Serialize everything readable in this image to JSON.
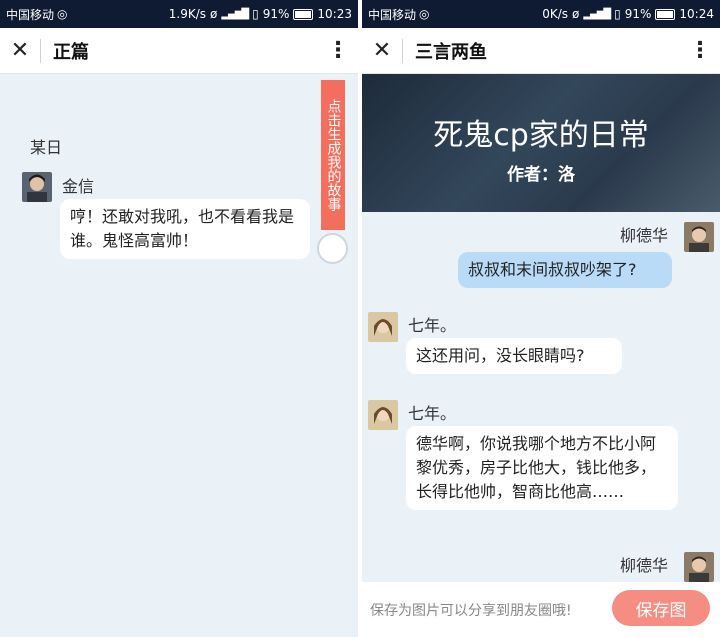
{
  "left": {
    "status": {
      "carrier": "中国移动",
      "speed": "1.9K/s",
      "battery": "91%",
      "time": "10:23"
    },
    "title": "正篇",
    "day_label": "某日",
    "messages": [
      {
        "speaker": "金信",
        "text": "哼！还敢对我吼，也不看看我是谁。鬼怪高富帅！"
      }
    ],
    "generate_tab": "点击生成我的故事"
  },
  "right": {
    "status": {
      "carrier": "中国移动",
      "speed": "0K/s",
      "battery": "91%",
      "time": "10:24"
    },
    "title": "三言两鱼",
    "banner": {
      "title": "死鬼cp家的日常",
      "author": "作者：洛"
    },
    "messages": [
      {
        "speaker": "柳德华",
        "text": "叔叔和末间叔叔吵架了?"
      },
      {
        "speaker": "七年。",
        "text": "这还用问，没长眼睛吗?"
      },
      {
        "speaker": "七年。",
        "text": "德华啊，你说我哪个地方不比小阿黎优秀，房子比他大，钱比他多，长得比他帅，智商比他高……"
      },
      {
        "speaker": "柳德华",
        "text": ""
      }
    ],
    "save_hint": "保存为图片可以分享到朋友圈哦!",
    "save_button": "保存图"
  },
  "colors": {
    "status_bar": "#0f1a33",
    "background": "#eaf1f7",
    "accent": "#f36e5d",
    "blue_bubble": "#b9dbf7"
  },
  "icons": {
    "close": "close-icon",
    "menu": "more-vertical-icon"
  }
}
